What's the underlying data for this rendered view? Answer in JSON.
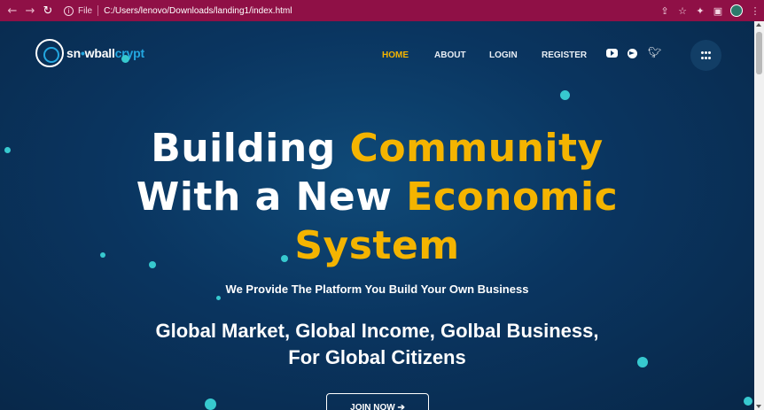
{
  "browser": {
    "address_prefix": "File",
    "url": "C:/Users/lenovo/Downloads/landing1/index.html",
    "icons": [
      "back-arrow-icon",
      "forward-arrow-icon",
      "reload-icon",
      "info-icon",
      "share-icon",
      "star-icon",
      "extensions-icon",
      "sidepanel-icon",
      "profile-avatar",
      "more-menu-icon"
    ]
  },
  "brand": {
    "name_part1": "sn",
    "name_part2": "wballcrypt",
    "name_part2_accent": "crypt",
    "name_part2_plain": "wball"
  },
  "nav": {
    "items": [
      "HOME",
      "ABOUT",
      "LOGIN",
      "REGISTER"
    ],
    "active_index": 0
  },
  "social": [
    "youtube-icon",
    "telegram-icon",
    "twitter-icon"
  ],
  "hero": {
    "line1_white": "Building",
    "line1_gold": "Community",
    "line2_white": "With a New",
    "line2_gold": "Economic",
    "line3_gold": "System",
    "subtitle": "We Provide The Platform You Build Your Own Business",
    "tagline1": "Global Market, Global Income, Golbal Business,",
    "tagline2": "For Global Citizens",
    "cta": "JOIN NOW ➔"
  },
  "colors": {
    "chrome": "#8f1046",
    "accent_gold": "#f4b400",
    "accent_blue": "#23a7e0",
    "particle": "#37c9cf",
    "background": "#0a3560"
  }
}
